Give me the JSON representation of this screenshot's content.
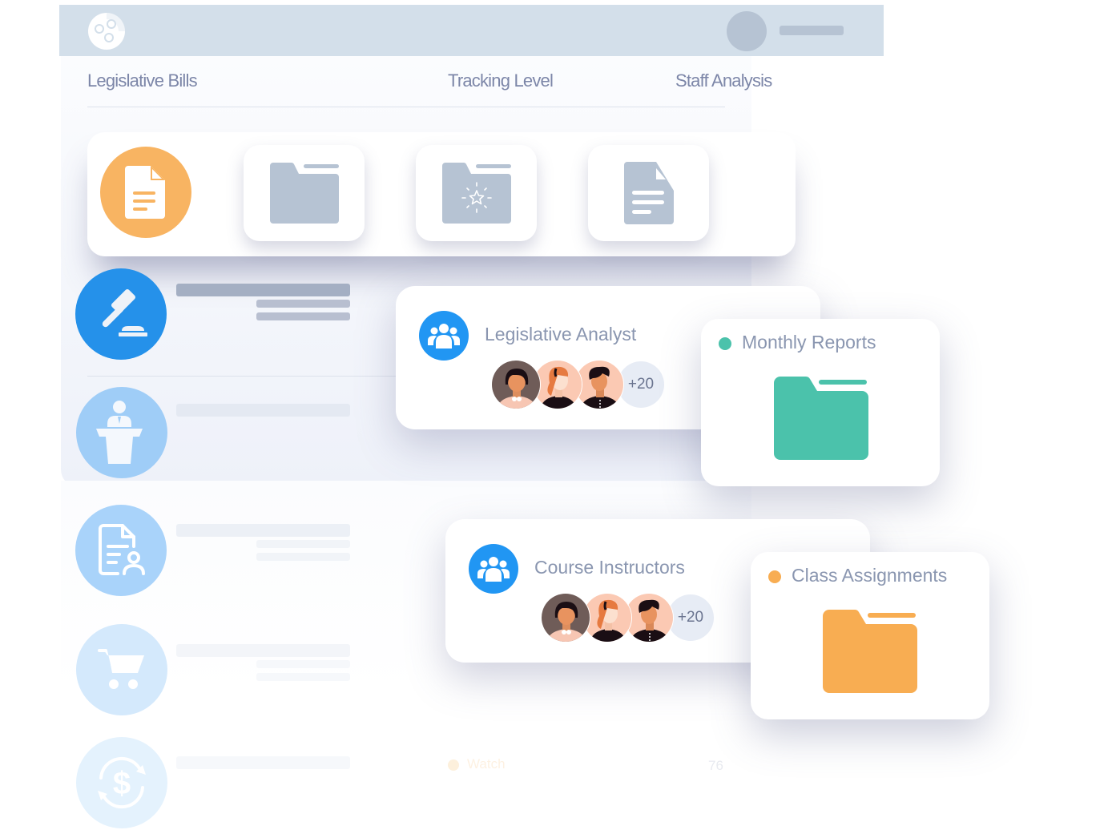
{
  "header": {
    "logo_icon": "film-reel-logo-icon",
    "avatar_icon": "user-avatar-placeholder",
    "username_placeholder": "username-skeleton"
  },
  "nav": {
    "tabs": [
      {
        "label": "Legislative Bills"
      },
      {
        "label": "Tracking Level"
      },
      {
        "label": "Staff Analysis"
      }
    ]
  },
  "toolbar": {
    "items": [
      {
        "icon": "document-icon",
        "active": true
      },
      {
        "icon": "folder-icon",
        "active": false
      },
      {
        "icon": "starred-folder-icon",
        "active": false
      },
      {
        "icon": "document-icon",
        "active": false
      }
    ]
  },
  "list": {
    "rows": [
      {
        "icon": "gavel-icon",
        "color": "#2591ea"
      },
      {
        "icon": "podium-speaker-icon",
        "color": "#9fcdf7"
      },
      {
        "icon": "document-user-icon",
        "color": "#a9d3fa"
      },
      {
        "icon": "shopping-cart-icon",
        "color": "#d4e9fc"
      },
      {
        "icon": "dollar-exchange-icon",
        "color": "#e4f2fd"
      }
    ],
    "faded_status": {
      "label": "Watch",
      "value": "76",
      "color": "#f8b462"
    }
  },
  "groups": [
    {
      "title": "Legislative Analyst",
      "icon": "users-group-icon",
      "more_count": "+20"
    },
    {
      "title": "Course Instructors",
      "icon": "users-group-icon",
      "more_count": "+20"
    }
  ],
  "folders": [
    {
      "title": "Monthly Reports",
      "color": "#4bc2ab",
      "icon": "folder-icon"
    },
    {
      "title": "Class Assignments",
      "color": "#f8ad52",
      "icon": "folder-icon"
    }
  ],
  "colors": {
    "accent_blue": "#2196f3",
    "topbar": "#d3dfea",
    "muted_text": "#8a96b0",
    "orange": "#f8b462",
    "teal": "#4bc2ab"
  }
}
